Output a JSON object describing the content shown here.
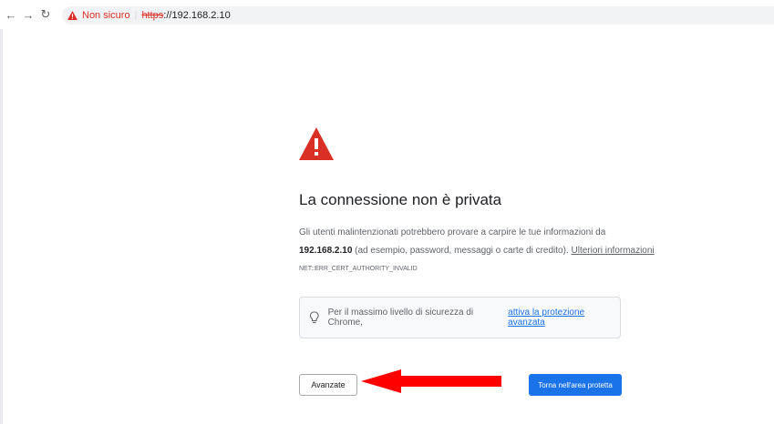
{
  "browser": {
    "security_label": "Non sicuro",
    "separator": "|",
    "url_scheme": "https",
    "url_rest": "://192.168.2.10"
  },
  "page": {
    "heading": "La connessione non è privata",
    "paragraph": {
      "line1": "Gli utenti malintenzionati potrebbero provare a carpire le tue informazioni da",
      "host": "192.168.2.10",
      "line2_rest": " (ad esempio, password, messaggi o carte di credito). ",
      "more_info_link": "Ulteriori informazioni"
    },
    "error_code": "NET::ERR_CERT_AUTHORITY_INVALID",
    "tip": {
      "text": "Per il massimo livello di sicurezza di Chrome,",
      "link": "attiva la protezione avanzata"
    },
    "advanced_button": "Avanzate",
    "back_button": "Torna nell'area protetta"
  },
  "colors": {
    "warning_red": "#d93025",
    "link_blue": "#1a73e8",
    "annotation_arrow": "#ff0000"
  }
}
